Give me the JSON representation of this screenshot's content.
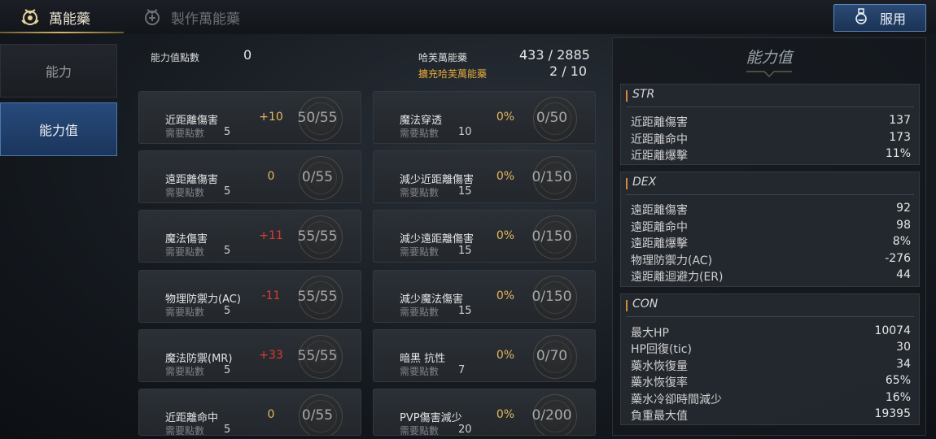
{
  "tabs": {
    "active_label": "萬能藥",
    "inactive_label": "製作萬能藥",
    "use_button_label": "服用"
  },
  "nav": {
    "item_ability": "能力",
    "item_stats": "能力值"
  },
  "header": {
    "points_label": "能力值點數",
    "points_value": "0",
    "elixir_label": "哈芙萬能藥",
    "elixir_value": "433 / 2885",
    "expand_label": "擴充哈芙萬能藥",
    "expand_value": "2 / 10"
  },
  "left_cards": [
    {
      "name": "近距離傷害",
      "req_label": "需要點數",
      "req": "5",
      "bonus": "+10",
      "bonus_color": "#e5b85f",
      "progress": "50/55"
    },
    {
      "name": "遠距離傷害",
      "req_label": "需要點數",
      "req": "5",
      "bonus": "0",
      "bonus_color": "#e5b85f",
      "progress": "0/55"
    },
    {
      "name": "魔法傷害",
      "req_label": "需要點數",
      "req": "5",
      "bonus": "+11",
      "bonus_color": "#e03a2f",
      "progress": "55/55"
    },
    {
      "name": "物理防禦力(AC)",
      "req_label": "需要點數",
      "req": "5",
      "bonus": "-11",
      "bonus_color": "#e03a2f",
      "progress": "55/55"
    },
    {
      "name": "魔法防禦(MR)",
      "req_label": "需要點數",
      "req": "5",
      "bonus": "+33",
      "bonus_color": "#e03a2f",
      "progress": "55/55"
    },
    {
      "name": "近距離命中",
      "req_label": "需要點數",
      "req": "5",
      "bonus": "0",
      "bonus_color": "#e5b85f",
      "progress": "0/55"
    }
  ],
  "right_cards": [
    {
      "name": "魔法穿透",
      "req_label": "需要點數",
      "req": "10",
      "bonus": "0%",
      "bonus_color": "#e5b85f",
      "progress": "0/50"
    },
    {
      "name": "減少近距離傷害",
      "req_label": "需要點數",
      "req": "15",
      "bonus": "0%",
      "bonus_color": "#e5b85f",
      "progress": "0/150"
    },
    {
      "name": "減少遠距離傷害",
      "req_label": "需要點數",
      "req": "15",
      "bonus": "0%",
      "bonus_color": "#e5b85f",
      "progress": "0/150"
    },
    {
      "name": "減少魔法傷害",
      "req_label": "需要點數",
      "req": "15",
      "bonus": "0%",
      "bonus_color": "#e5b85f",
      "progress": "0/150"
    },
    {
      "name": "暗黑 抗性",
      "req_label": "需要點數",
      "req": "7",
      "bonus": "0%",
      "bonus_color": "#e5b85f",
      "progress": "0/70"
    },
    {
      "name": "PVP傷害減少",
      "req_label": "需要點數",
      "req": "20",
      "bonus": "0%",
      "bonus_color": "#e5b85f",
      "progress": "0/200"
    }
  ],
  "stats_panel": {
    "title": "能力值",
    "str": {
      "name": "STR",
      "rows": [
        {
          "k": "近距離傷害",
          "v": "137"
        },
        {
          "k": "近距離命中",
          "v": "173"
        },
        {
          "k": "近距離爆擊",
          "v": "11%"
        }
      ]
    },
    "dex": {
      "name": "DEX",
      "rows": [
        {
          "k": "遠距離傷害",
          "v": "92"
        },
        {
          "k": "遠距離命中",
          "v": "98"
        },
        {
          "k": "遠距離爆擊",
          "v": "8%"
        },
        {
          "k": "物理防禦力(AC)",
          "v": "-276"
        },
        {
          "k": "遠距離迴避力(ER)",
          "v": "44"
        }
      ]
    },
    "con": {
      "name": "CON",
      "rows": [
        {
          "k": "最大HP",
          "v": "10074"
        },
        {
          "k": "HP回復(tic)",
          "v": "30"
        },
        {
          "k": "藥水恢復量",
          "v": "34"
        },
        {
          "k": "藥水恢復率",
          "v": "65%"
        },
        {
          "k": "藥水冷卻時間減少",
          "v": "16%"
        },
        {
          "k": "負重最大值",
          "v": "19395"
        }
      ]
    }
  },
  "colors": {
    "accent_gold": "#e5b85f",
    "negative_red": "#e03a2f",
    "section_marker": "#d48a3a",
    "nav_active": "#274a7b"
  }
}
